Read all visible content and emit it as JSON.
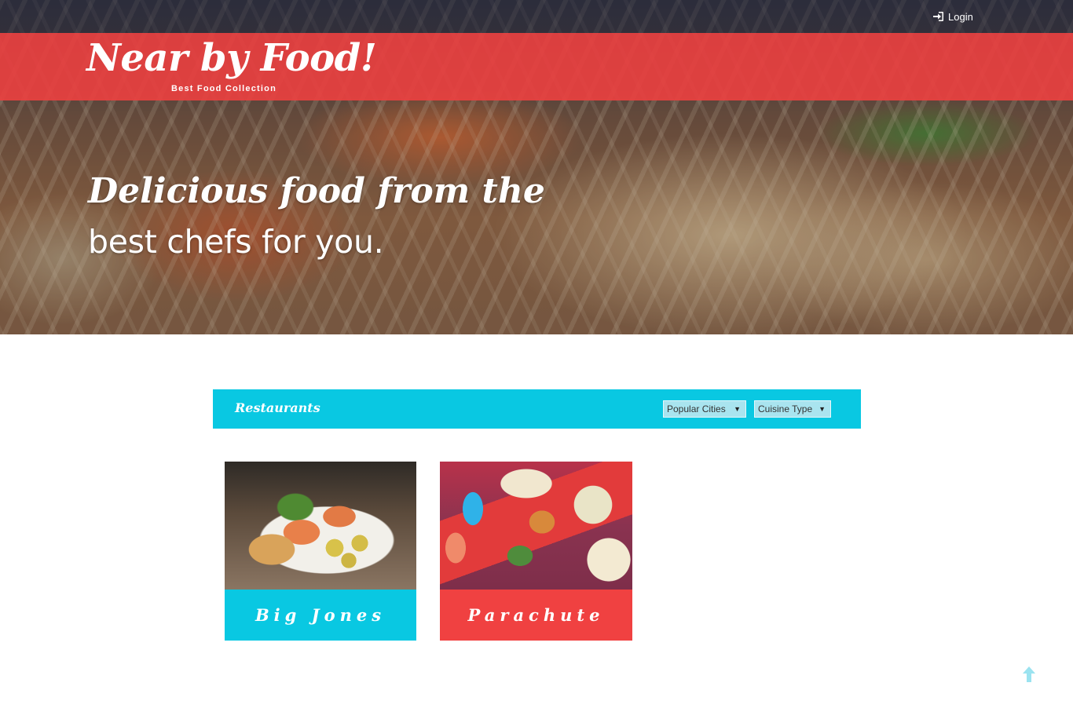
{
  "header": {
    "login_label": "Login",
    "login_icon": "sign-in-icon",
    "brand_title": "Near by Food!",
    "brand_tagline": "Best Food Collection"
  },
  "hero": {
    "headline_line1": "Delicious food from the",
    "headline_line2": "best chefs for you."
  },
  "restaurants": {
    "section_title": "Restaurants",
    "filters": {
      "cities_selected": "Popular Cities",
      "cuisine_selected": "Cuisine Type"
    },
    "cards": [
      {
        "name": "Big Jones",
        "accent": "#09c8e2"
      },
      {
        "name": "Parachute",
        "accent": "#f04141"
      }
    ]
  },
  "colors": {
    "brand_red": "#ec4040",
    "accent_cyan": "#09c8e2",
    "scroll_icon": "#9be3f0"
  },
  "footer": {
    "scroll_top_icon": "arrow-up-icon"
  }
}
